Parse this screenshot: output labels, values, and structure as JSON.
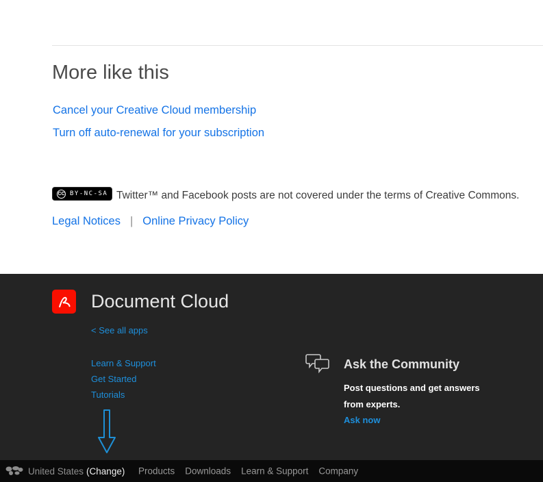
{
  "more_like_this": {
    "title": "More like this",
    "links": [
      "Cancel your Creative Cloud membership",
      "Turn off auto-renewal for your subscription"
    ]
  },
  "legal": {
    "cc_label": "CC",
    "cc_license": "BY-NC-SA",
    "notice": "Twitter™ and Facebook posts are not covered under the terms of Creative Commons.",
    "links": [
      "Legal Notices",
      "Online Privacy Policy"
    ],
    "separator": "|"
  },
  "footer": {
    "product_name": "Document Cloud",
    "see_all_apps": "< See all apps",
    "links": [
      "Learn & Support",
      "Get Started",
      "Tutorials"
    ],
    "community": {
      "title": "Ask the Community",
      "description": "Post questions and get answers from experts.",
      "cta": "Ask now"
    }
  },
  "bottom_bar": {
    "region": "United States",
    "change_label": "(Change)",
    "nav": [
      "Products",
      "Downloads",
      "Learn & Support",
      "Company"
    ]
  },
  "icons": {
    "logo": "acrobat-logo",
    "community": "community-chat-icon",
    "globe": "globe-icon",
    "annotation": "down-arrow-annotation"
  },
  "colors": {
    "link_blue": "#1473e6",
    "footer_link_blue": "#1e8fdb",
    "footer_bg": "#242424",
    "bottom_bar_bg": "#0a0a0a",
    "brand_red": "#fa0f00"
  }
}
